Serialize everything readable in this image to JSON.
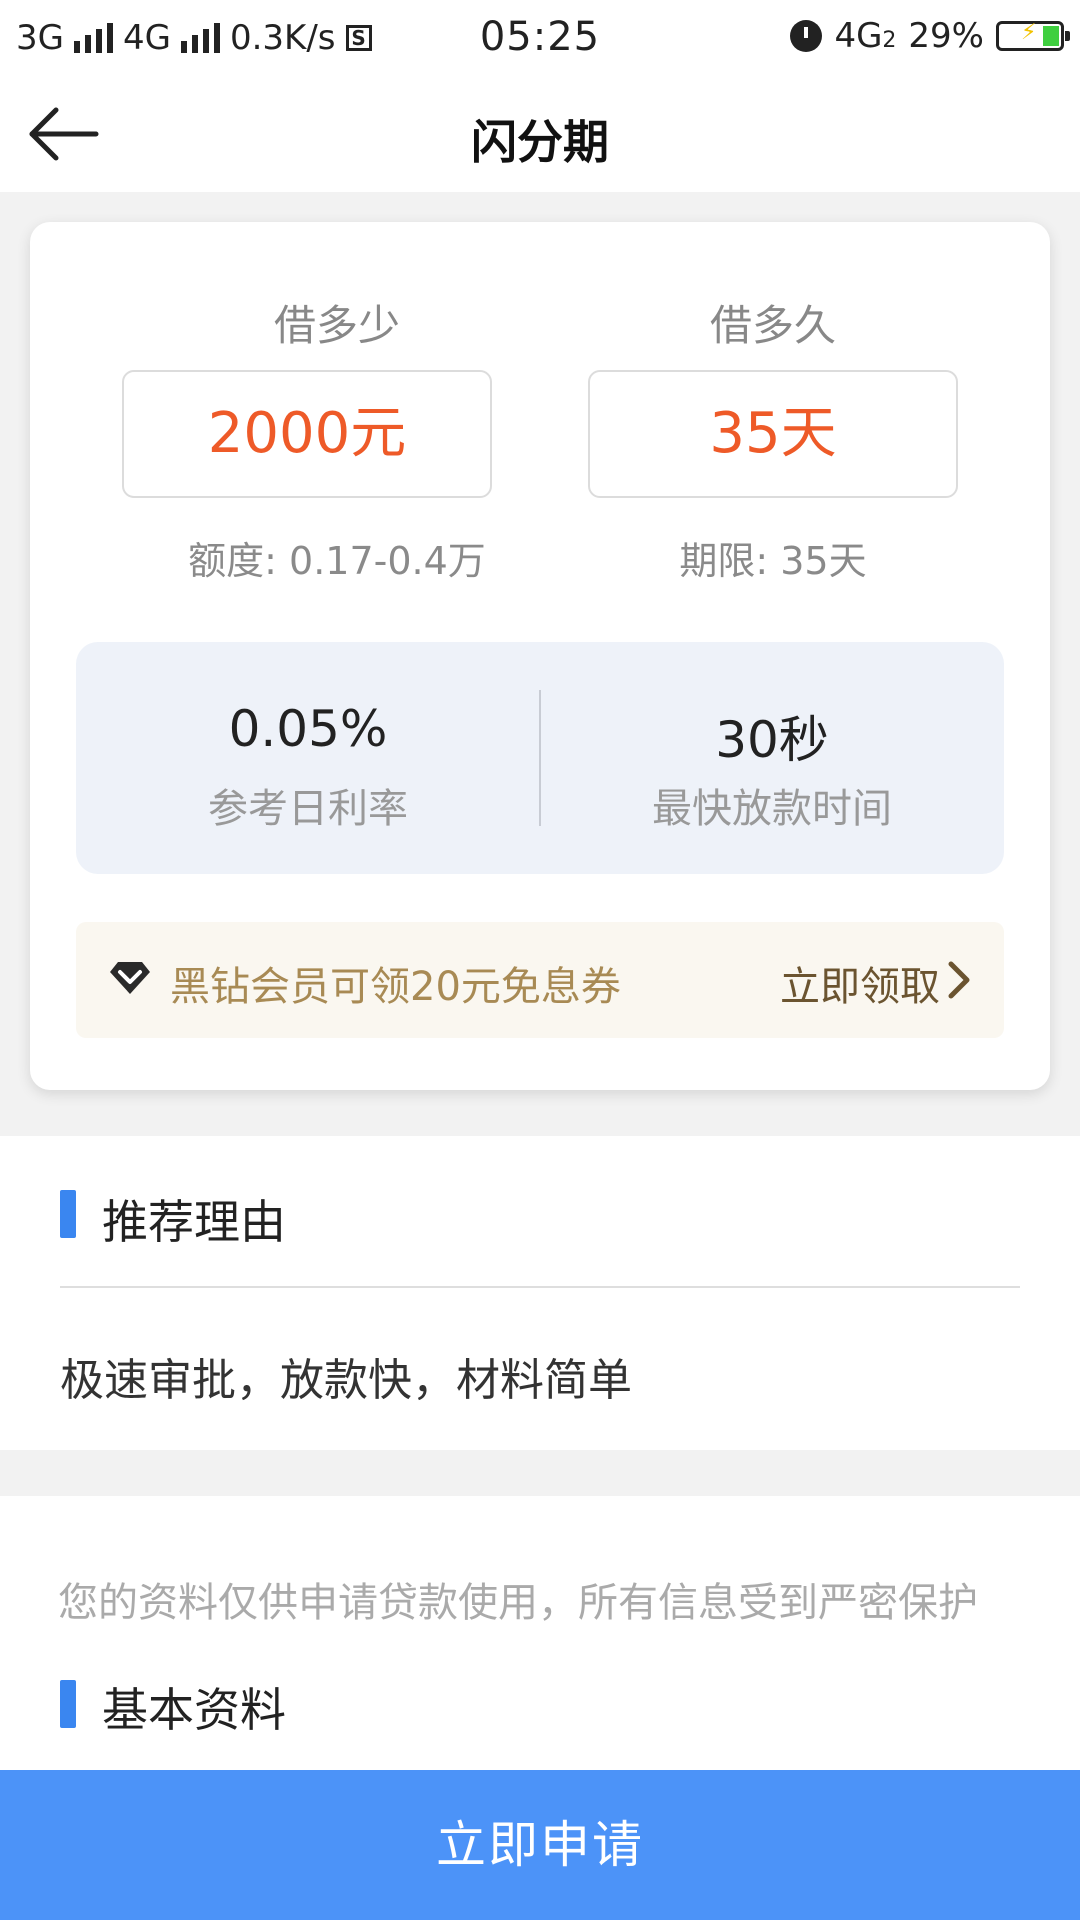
{
  "status_bar": {
    "network1": "3G",
    "network2": "4G",
    "speed": "0.3K/s",
    "s_icon_label": "S",
    "time": "05:25",
    "network3": "4G",
    "network3_sub": "2",
    "battery": "29%",
    "battery_level": 0.29,
    "icons": [
      "signal-icon",
      "alarm-icon",
      "battery-icon"
    ]
  },
  "nav": {
    "title": "闪分期",
    "back_icon": "back-arrow-icon"
  },
  "loan": {
    "amount_label": "借多少",
    "amount_value": "2000元",
    "amount_range": "额度: 0.17-0.4万",
    "term_label": "借多久",
    "term_value": "35天",
    "term_range": "期限: 35天",
    "accent_color": "#ee5a28"
  },
  "stats": {
    "rate_value": "0.05%",
    "rate_label": "参考日利率",
    "speed_value": "30秒",
    "speed_label": "最快放款时间"
  },
  "vip": {
    "icon": "diamond-icon",
    "text": "黑钻会员可领20元免息券",
    "action": "立即领取",
    "action_icon": "chevron-right-icon"
  },
  "reason": {
    "title": "推荐理由",
    "text": "极速审批，放款快，材料简单"
  },
  "basic_info": {
    "privacy_note": "您的资料仅供申请贷款使用，所有信息受到严密保护",
    "title": "基本资料"
  },
  "apply_button": {
    "label": "立即申请",
    "color": "#4c93f8"
  },
  "section_marker_color": "#3a86f0"
}
